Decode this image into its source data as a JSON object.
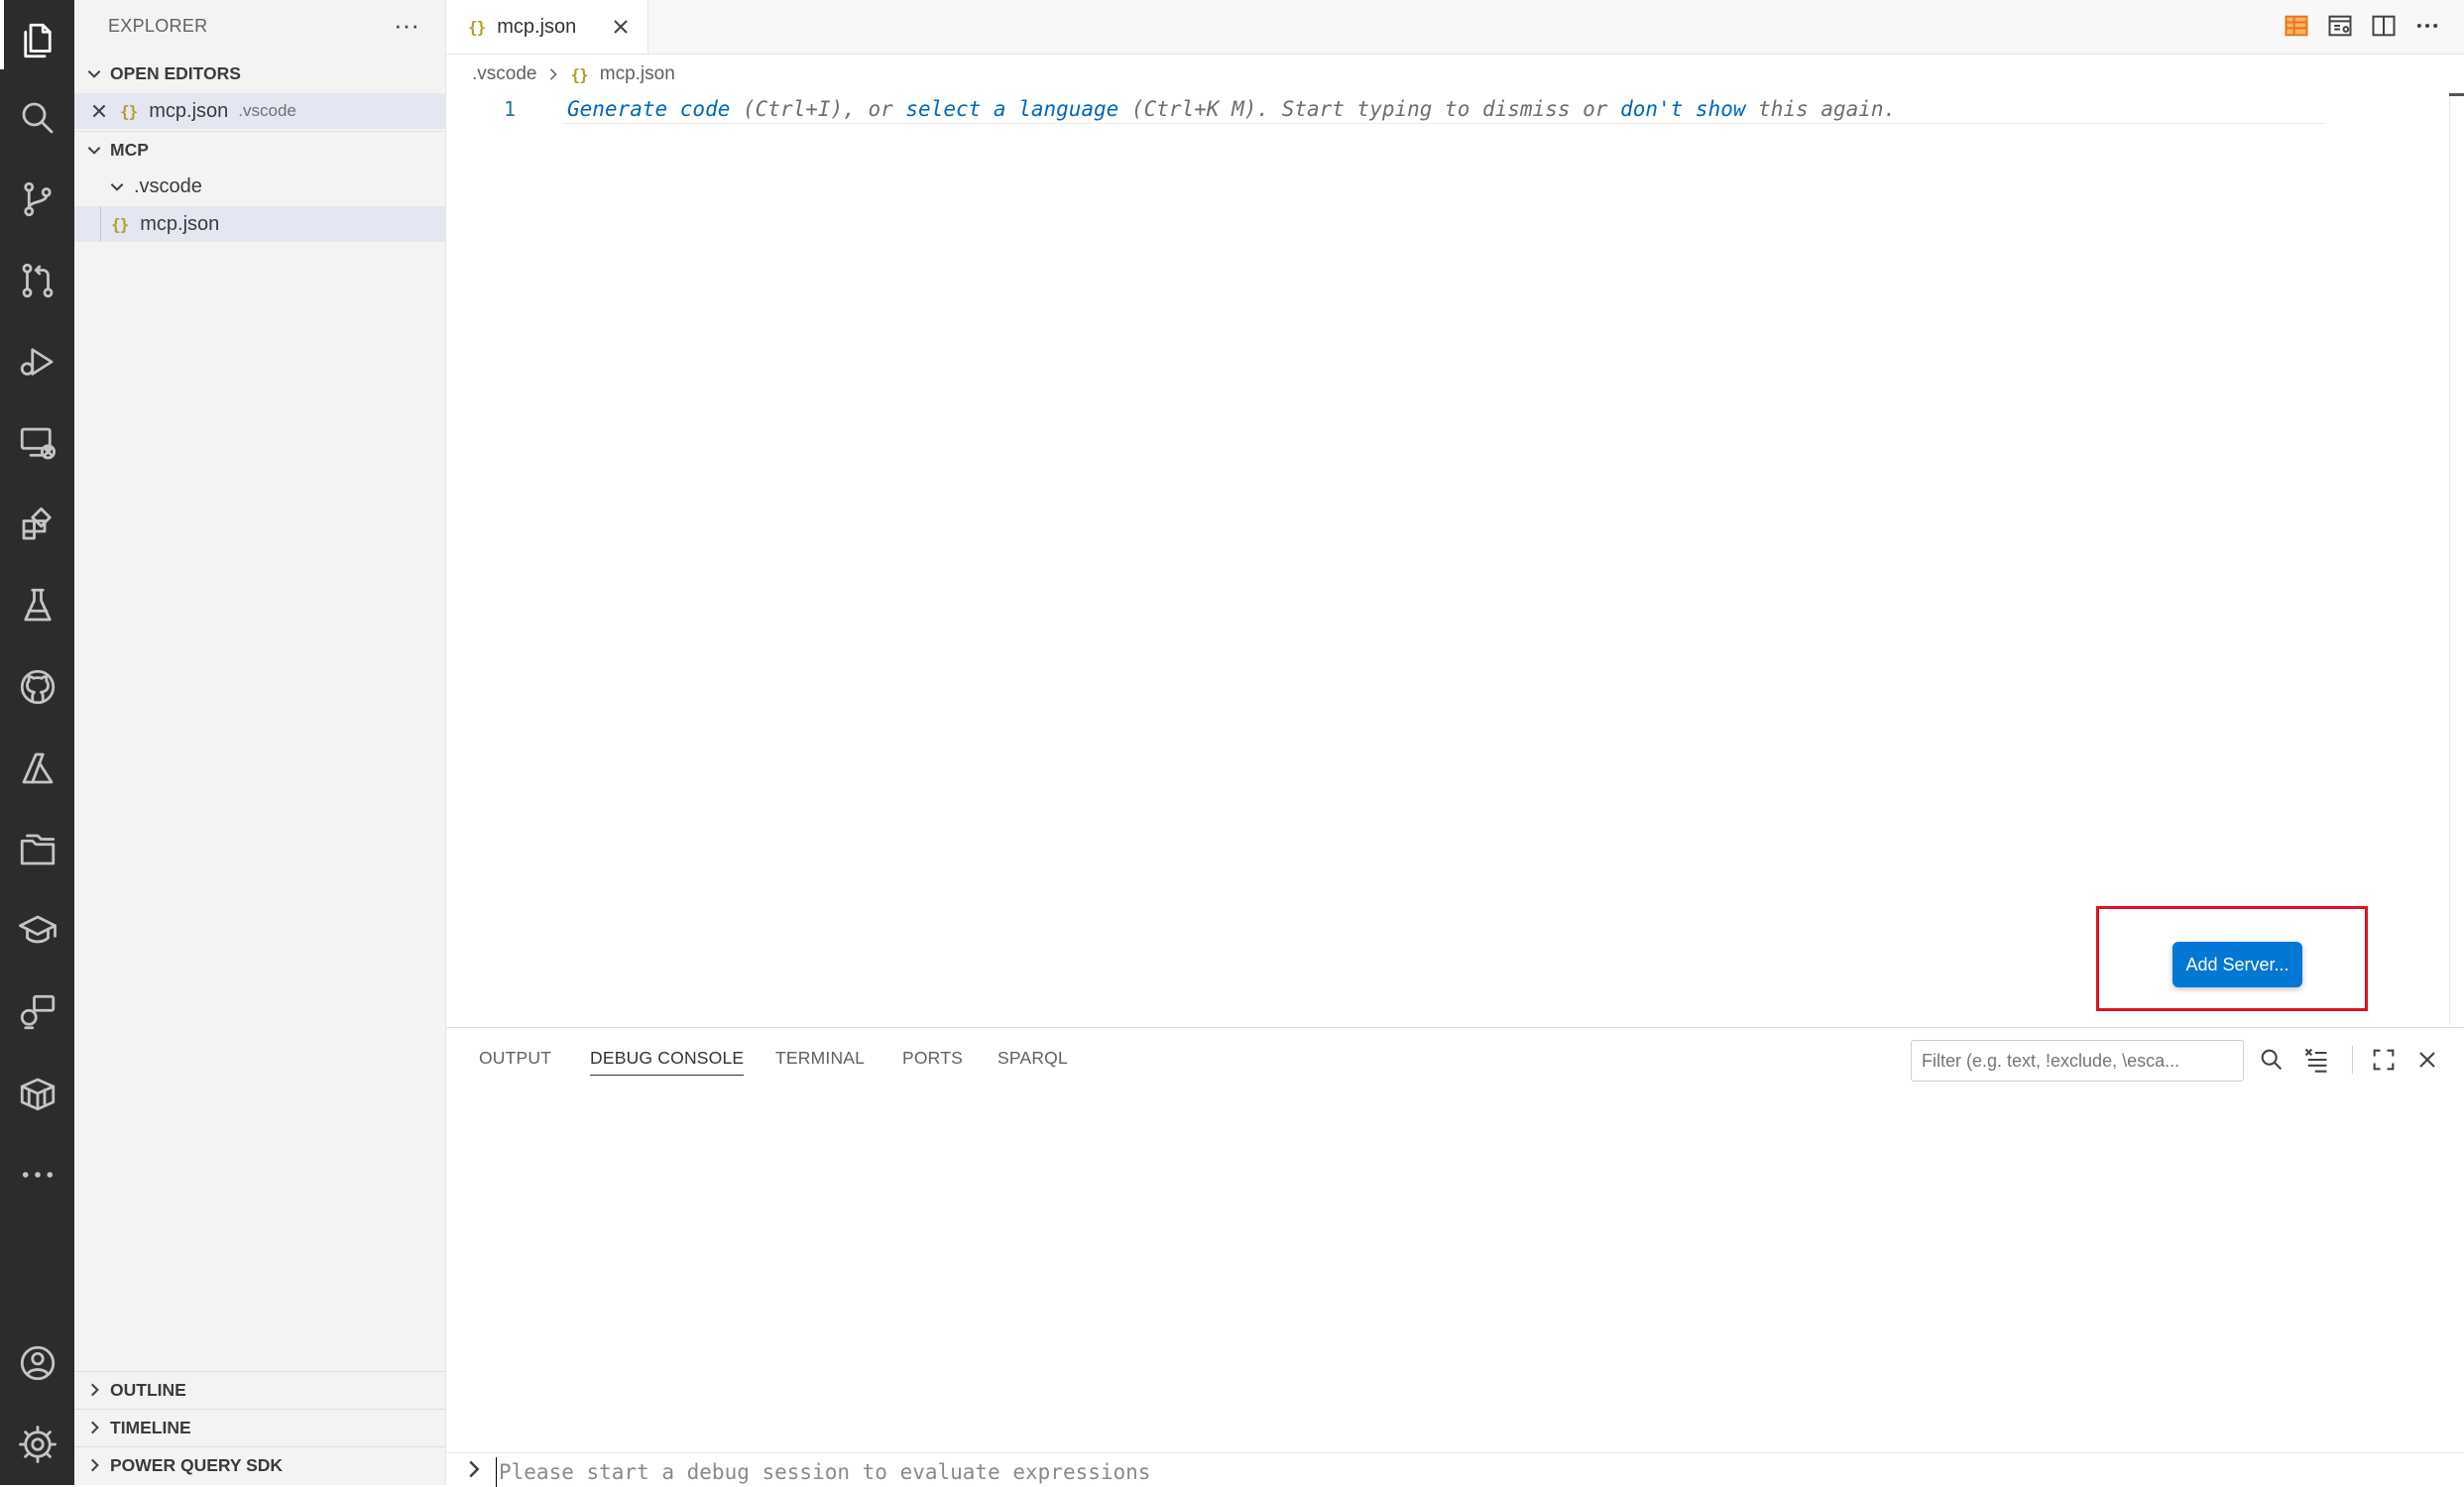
{
  "sidebar": {
    "title": "EXPLORER",
    "more_label": "···",
    "open_editors_header": "OPEN EDITORS",
    "open_editors": [
      {
        "name": "mcp.json",
        "description": ".vscode"
      }
    ],
    "workspace_header": "MCP",
    "tree": {
      "folder": ".vscode",
      "file": "mcp.json"
    },
    "outline_header": "OUTLINE",
    "timeline_header": "TIMELINE",
    "pq_header": "POWER QUERY SDK"
  },
  "tab": {
    "label": "mcp.json",
    "icon_glyph": "{}"
  },
  "breadcrumb": {
    "folder": ".vscode",
    "file": "mcp.json"
  },
  "editor": {
    "line_number": "1",
    "hint": {
      "generate": "Generate code",
      "t1": " (Ctrl+I), or ",
      "select": "select a language",
      "t2": " (Ctrl+K M). Start typing to dismiss or ",
      "dont_show": "don't show",
      "t3": " this again."
    },
    "add_server_label": "Add Server..."
  },
  "panel": {
    "tabs": [
      "OUTPUT",
      "DEBUG CONSOLE",
      "TERMINAL",
      "PORTS",
      "SPARQL"
    ],
    "active_tab": "DEBUG CONSOLE",
    "filter_placeholder": "Filter (e.g. text, !exclude, \\esca...",
    "repl_placeholder": "Please start a debug session to evaluate expressions"
  },
  "colors": {
    "accent": "#0078d4",
    "highlight": "#e01020",
    "activity_bar": "#2c2c2c"
  }
}
